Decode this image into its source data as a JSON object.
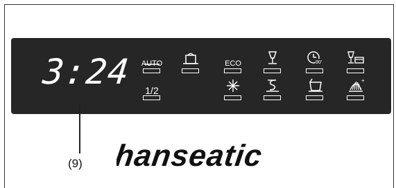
{
  "display": {
    "time": "3:24"
  },
  "callout": {
    "label": "(9)"
  },
  "brand": {
    "name": "hanseatic"
  },
  "buttons": [
    {
      "name": "auto-program-button",
      "label": "AUTO",
      "icon": "auto-icon"
    },
    {
      "name": "half-load-button",
      "label": "1/2",
      "icon": "half-load-icon"
    },
    {
      "name": "intensive-pot-button",
      "label": "",
      "icon": "pot-icon"
    },
    {
      "name": "eco-program-button",
      "label": "ECO",
      "icon": "eco-icon"
    },
    {
      "name": "hygiene-button",
      "label": "",
      "icon": "sparkle-icon"
    },
    {
      "name": "glass-program-button",
      "label": "",
      "icon": "glass-icon"
    },
    {
      "name": "rinse-button",
      "label": "",
      "icon": "rinse-icon"
    },
    {
      "name": "quick-90-button",
      "label": "",
      "icon": "clock-90-icon"
    },
    {
      "name": "prewash-button",
      "label": "",
      "icon": "basket-icon"
    },
    {
      "name": "glass-and-dish-button",
      "label": "",
      "icon": "glass-dish-icon"
    },
    {
      "name": "drying-button",
      "label": "",
      "icon": "drying-icon"
    }
  ],
  "colors": {
    "panel": "#262626",
    "indicator": "#ffffff"
  }
}
